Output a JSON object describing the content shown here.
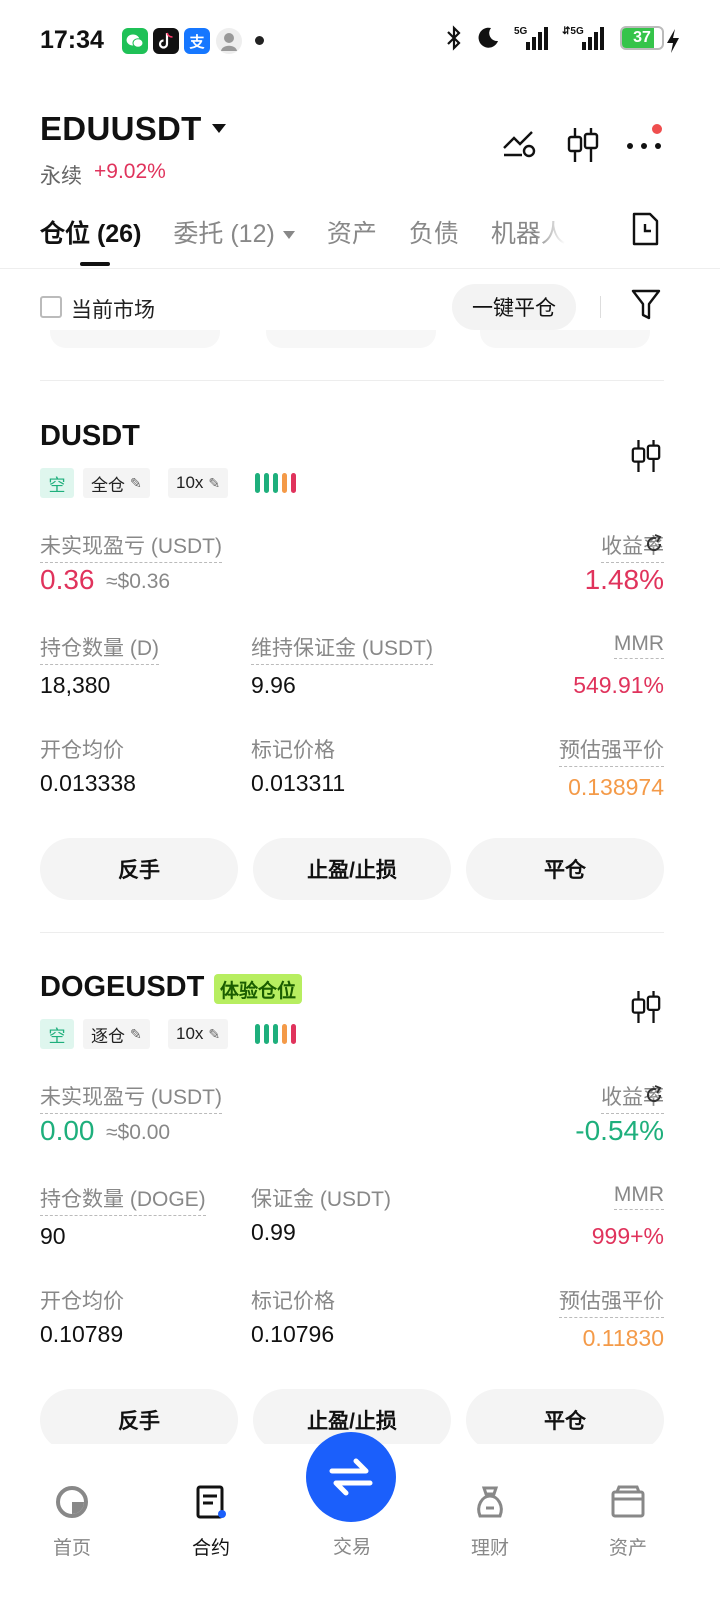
{
  "status_bar": {
    "time": "17:34",
    "app_icons": [
      "wechat-icon",
      "tiktok-icon",
      "alipay-icon",
      "avatar-icon"
    ],
    "battery": "37",
    "network": [
      "5G",
      "5G"
    ]
  },
  "header": {
    "symbol": "EDUUSDT",
    "contract_type": "永续",
    "change": "+9.02%",
    "icons": [
      "strategy-icon",
      "candlestick-icon",
      "more-icon"
    ]
  },
  "tabs": [
    {
      "label": "仓位 (26)",
      "active": true
    },
    {
      "label": "委托 (12)",
      "active": false
    },
    {
      "label": "资产",
      "active": false
    },
    {
      "label": "负债",
      "active": false
    },
    {
      "label": "机器人",
      "active": false
    }
  ],
  "filter": {
    "current_market": "当前市场",
    "close_all": "一键平仓"
  },
  "positions": [
    {
      "symbol": "DUSDT",
      "side": "空",
      "margin_mode": "全仓",
      "leverage": "10x",
      "unrealized_pnl_label": "未实现盈亏 (USDT)",
      "unrealized_pnl": "0.36",
      "unrealized_pnl_usd": "≈$0.36",
      "roe_label": "收益率",
      "roe": "1.48%",
      "qty_label": "持仓数量 (D)",
      "qty": "18,380",
      "margin_label": "维持保证金 (USDT)",
      "margin": "9.96",
      "mmr_label": "MMR",
      "mmr": "549.91%",
      "entry_label": "开仓均价",
      "entry": "0.013338",
      "mark_label": "标记价格",
      "mark": "0.013311",
      "liq_label": "预估强平价",
      "liq": "0.138974",
      "actions": [
        "反手",
        "止盈/止损",
        "平仓"
      ]
    },
    {
      "symbol": "DOGEUSDT",
      "badge": "体验仓位",
      "side": "空",
      "margin_mode": "逐仓",
      "leverage": "10x",
      "unrealized_pnl_label": "未实现盈亏 (USDT)",
      "unrealized_pnl": "0.00",
      "unrealized_pnl_usd": "≈$0.00",
      "roe_label": "收益率",
      "roe": "-0.54%",
      "qty_label": "持仓数量 (DOGE)",
      "qty": "90",
      "margin_label": "保证金 (USDT)",
      "margin": "0.99",
      "mmr_label": "MMR",
      "mmr": "999+%",
      "entry_label": "开仓均价",
      "entry": "0.10789",
      "mark_label": "标记价格",
      "mark": "0.10796",
      "liq_label": "预估强平价",
      "liq": "0.11830",
      "actions": [
        "反手",
        "止盈/止损",
        "平仓"
      ]
    }
  ],
  "colors": {
    "up_red": "#e0335c",
    "down_green": "#1eaf7c",
    "liq_orange": "#f49a48",
    "trade_blue": "#1b5ffb"
  },
  "bottom_nav": [
    {
      "label": "首页",
      "icon": "home-icon"
    },
    {
      "label": "合约",
      "icon": "futures-icon",
      "active": true
    },
    {
      "label": "交易",
      "icon": "swap-icon"
    },
    {
      "label": "理财",
      "icon": "earn-icon"
    },
    {
      "label": "资产",
      "icon": "wallet-icon"
    }
  ]
}
